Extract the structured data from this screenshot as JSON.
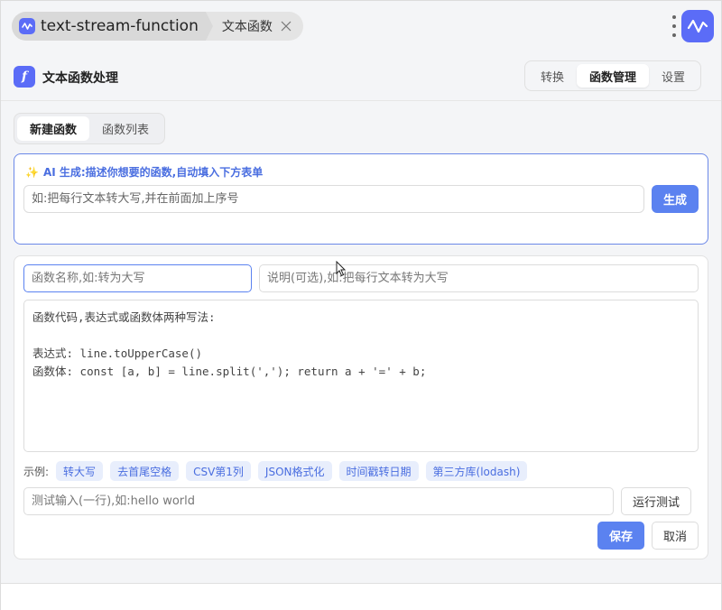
{
  "titlebar": {
    "app_name": "text-stream-function",
    "tab_label": "文本函数"
  },
  "header": {
    "title": "文本函数处理",
    "badge": "f",
    "tabs": [
      {
        "label": "转换",
        "active": false
      },
      {
        "label": "函数管理",
        "active": true
      },
      {
        "label": "设置",
        "active": false
      }
    ]
  },
  "subtabs": [
    {
      "label": "新建函数",
      "active": true
    },
    {
      "label": "函数列表",
      "active": false
    }
  ],
  "ai": {
    "heading": "AI 生成:描述你想要的函数,自动填入下方表单",
    "placeholder": "如:把每行文本转大写,并在前面加上序号",
    "button": "生成"
  },
  "form": {
    "name_placeholder": "函数名称,如:转为大写",
    "desc_placeholder": "说明(可选),如:把每行文本转为大写",
    "code_placeholder": "函数代码,表达式或函数体两种写法:\n\n表达式: line.toUpperCase()\n函数体: const [a, b] = line.split(','); return a + '=' + b;",
    "examples_label": "示例:",
    "examples": [
      "转大写",
      "去首尾空格",
      "CSV第1列",
      "JSON格式化",
      "时间戳转日期",
      "第三方库(lodash)"
    ],
    "test_placeholder": "测试输入(一行),如:hello world",
    "run_button": "运行测试",
    "save_button": "保存",
    "cancel_button": "取消"
  },
  "colors": {
    "accent": "#5b82f0",
    "brand": "#5b6cf7",
    "chip_bg": "#e8eefc"
  }
}
